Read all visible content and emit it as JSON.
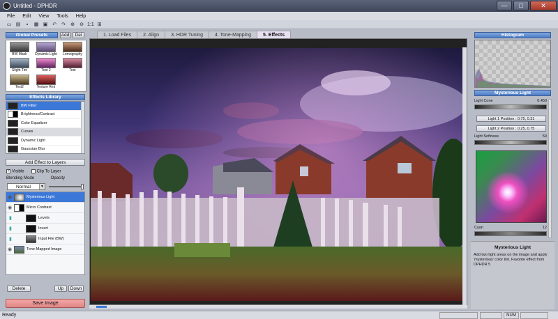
{
  "window": {
    "title": "Untitled - DPHDR",
    "min": "—",
    "max": "□",
    "close": "✕"
  },
  "menu": [
    "File",
    "Edit",
    "View",
    "Tools",
    "Help"
  ],
  "toolbar": {
    "zoom": "1:1"
  },
  "presets": {
    "header": "Global Presets",
    "add": "Add",
    "del": "Del",
    "items": [
      {
        "label": "BW Mask",
        "color": "#555"
      },
      {
        "label": "Dynamic Light",
        "color": "#8a7ab0"
      },
      {
        "label": "Lomography",
        "color": "#9a6a5a"
      },
      {
        "label": "Slight Tint",
        "color": "#6a7a8a"
      },
      {
        "label": "Test 2",
        "color": "#b04a90"
      },
      {
        "label": "Test",
        "color": "#a05a6a"
      },
      {
        "label": "Test2",
        "color": "#7a6a50"
      },
      {
        "label": "Texture Red",
        "color": "#a03030"
      }
    ]
  },
  "effects": {
    "header": "Effects Library",
    "add_btn": "Add Effect to Layers",
    "items": [
      {
        "label": "BW Filter"
      },
      {
        "label": "Brightness/Contrast"
      },
      {
        "label": "Color Equalizer"
      },
      {
        "label": "Curves"
      },
      {
        "label": "Dynamic Light"
      },
      {
        "label": "Gaussian Blur"
      }
    ]
  },
  "layer_opts": {
    "visible": "Visible",
    "clip": "Clip To Layer",
    "blend_label": "Blending Mode",
    "opacity_label": "Opacity",
    "blend_value": "Normal"
  },
  "layers": [
    {
      "label": "Mysterious Light"
    },
    {
      "label": "Micro Contrast"
    },
    {
      "label": "Levels"
    },
    {
      "label": "Invert"
    },
    {
      "label": "Input File (BW)"
    },
    {
      "label": "Tone-Mapped Image"
    }
  ],
  "layer_buttons": {
    "delete": "Delete",
    "up": "Up",
    "down": "Down"
  },
  "save": "Save Image",
  "tabs": [
    "1. Load Files",
    "2. Align",
    "3. HDR Tuning",
    "4. Tone-Mapping",
    "5. Effects"
  ],
  "right": {
    "histogram": "Histogram",
    "effect_title": "Mysterious Light",
    "light_cone_label": "Light Cone",
    "light_cone_value": "0.450",
    "light1": "Light 1 Position : 0.75, 0.31",
    "light2": "Light 2 Position : 0.25, 0.75",
    "softness_label": "Light Softness",
    "softness_value": "50",
    "cyan_label": "Cyan",
    "cyan_value": "12",
    "desc_title": "Mysterious Light",
    "desc_text": "Add two light areas on the image and apply 'mysterious' color tint. Favorite effect from DPHDR 5"
  },
  "status": {
    "text": "Ready",
    "num": "NUM"
  }
}
